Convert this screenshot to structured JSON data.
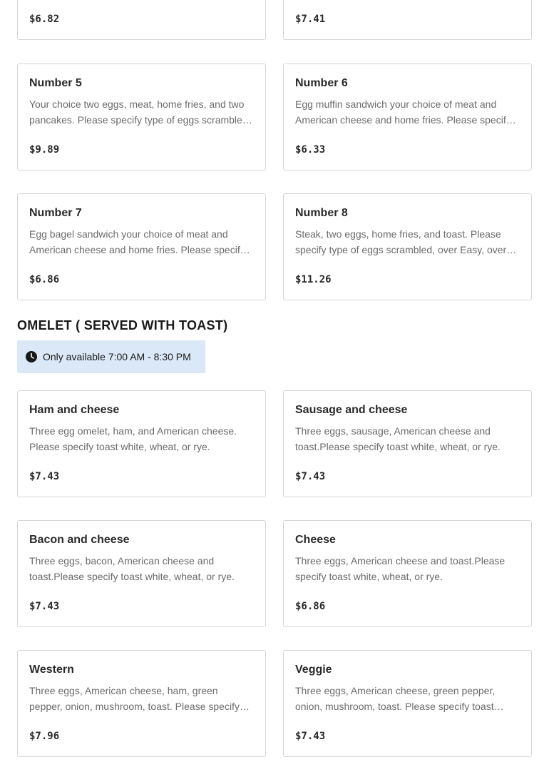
{
  "top_items": [
    {
      "price": "$6.82"
    },
    {
      "price": "$7.41"
    }
  ],
  "breakfast_items": [
    {
      "name": "Number 5",
      "description": "Your choice two eggs, meat, home fries, and two pancakes. Please specify type of eggs scrambled, over Easy, over Medium, or over Hard.",
      "price": "$9.89"
    },
    {
      "name": "Number 6",
      "description": "Egg muffin sandwich your choice of meat and American cheese and home fries. Please specify type of eggs.",
      "price": "$6.33"
    },
    {
      "name": "Number 7",
      "description": "Egg bagel sandwich your choice of meat and American cheese and home fries. Please specify type of eggs.",
      "price": "$6.86"
    },
    {
      "name": "Number 8",
      "description": "Steak, two eggs, home fries, and toast. Please specify type of eggs scrambled, over Easy, over Medium, or over Hard.",
      "price": "$11.26"
    }
  ],
  "omelet_section": {
    "title": "OMELET ( SERVED WITH TOAST)",
    "availability": "Only available 7:00 AM - 8:30 PM",
    "icon": "clock-icon"
  },
  "omelet_items": [
    {
      "name": "Ham and cheese",
      "description": "Three egg omelet, ham, and American cheese. Please specify toast white, wheat, or rye.",
      "price": "$7.43"
    },
    {
      "name": "Sausage and cheese",
      "description": "Three eggs, sausage, American cheese and toast.Please specify toast white, wheat, or rye.",
      "price": "$7.43"
    },
    {
      "name": "Bacon and cheese",
      "description": "Three eggs, bacon, American cheese and toast.Please specify toast white, wheat, or rye.",
      "price": "$7.43"
    },
    {
      "name": "Cheese",
      "description": "Three eggs, American cheese and toast.Please specify toast white, wheat, or rye.",
      "price": "$6.86"
    },
    {
      "name": "Western",
      "description": "Three eggs, American cheese, ham, green pepper, onion, mushroom, toast. Please specify toast white, wheat, or rye.",
      "price": "$7.96"
    },
    {
      "name": "Veggie",
      "description": "Three eggs, American cheese, green pepper, onion, mushroom, toast. Please specify toast white, wheat, or rye.",
      "price": "$7.43"
    }
  ],
  "colors": {
    "card_border": "#d6d6d6",
    "availability_bg": "#dbe8f7",
    "description_text": "#6b6b6b",
    "heading_text": "#191919"
  }
}
